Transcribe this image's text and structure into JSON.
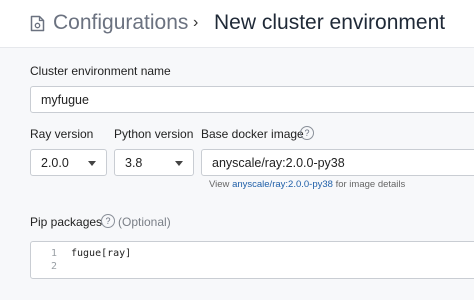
{
  "breadcrumb": {
    "parent": "Configurations",
    "separator": "›",
    "current": "New cluster environment"
  },
  "form": {
    "name_label": "Cluster environment name",
    "name_value": "myfugue",
    "ray_version_label": "Ray version",
    "ray_version_value": "2.0.0",
    "python_version_label": "Python version",
    "python_version_value": "3.8",
    "docker_image_label": "Base docker image",
    "docker_image_value": "anyscale/ray:2.0.0-py38",
    "docker_hint_prefix": "View",
    "docker_hint_link": "anyscale/ray:2.0.0-py38",
    "docker_hint_suffix": "for image details",
    "pip_label": "Pip packages",
    "pip_optional": "(Optional)",
    "pip_lines": [
      {
        "number": "1",
        "text": "fugue[ray]"
      },
      {
        "number": "2",
        "text": ""
      }
    ]
  },
  "icons": {
    "breadcrumb_icon": "document-settings-icon",
    "help_icon": "question-circle-icon",
    "dropdown_icon": "caret-down-icon"
  },
  "colors": {
    "link": "#1f5fa8",
    "panel_bg": "#f7f8fa",
    "muted_text": "#6b7280"
  }
}
